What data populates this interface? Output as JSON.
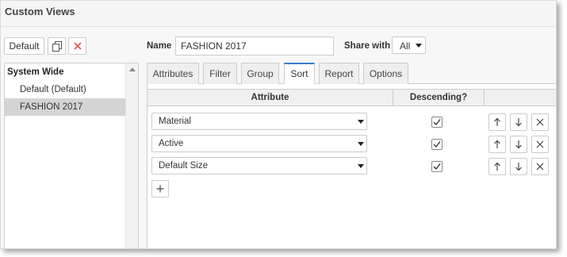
{
  "window": {
    "title": "Custom Views"
  },
  "toolbar": {
    "default_label": "Default"
  },
  "views_list": {
    "group_label": "System Wide",
    "items": [
      {
        "label": "Default (Default)",
        "selected": false
      },
      {
        "label": "FASHION 2017",
        "selected": true
      }
    ]
  },
  "form": {
    "name_label": "Name",
    "name_value": "FASHION 2017",
    "share_label": "Share with",
    "share_value": "All"
  },
  "tabs": [
    {
      "label": "Attributes",
      "active": false
    },
    {
      "label": "Filter",
      "active": false
    },
    {
      "label": "Group",
      "active": false
    },
    {
      "label": "Sort",
      "active": true
    },
    {
      "label": "Report",
      "active": false
    },
    {
      "label": "Options",
      "active": false
    }
  ],
  "sort_table": {
    "headers": {
      "attribute": "Attribute",
      "descending": "Descending?"
    },
    "rows": [
      {
        "attribute": "Material",
        "descending": true
      },
      {
        "attribute": "Active",
        "descending": true
      },
      {
        "attribute": "Default Size",
        "descending": true
      }
    ]
  },
  "icons": {
    "copy": "copy-icon",
    "delete": "close-icon",
    "move_up": "arrow-up-icon",
    "move_down": "arrow-down-icon",
    "remove": "close-icon",
    "add": "plus-icon"
  },
  "colors": {
    "delete_red": "#d9534f",
    "active_tab": "#3a7dc9",
    "selected_row": "#d4d4d4"
  }
}
